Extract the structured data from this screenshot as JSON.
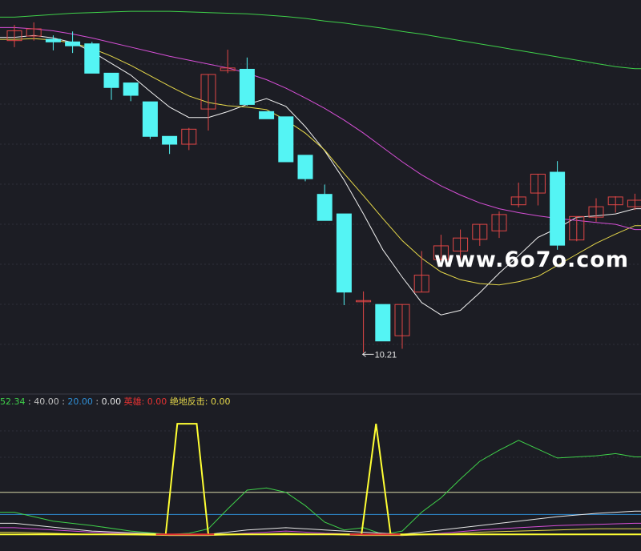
{
  "colors": {
    "background": "#1c1d24",
    "up_candle": "#e04646",
    "down_candle": "#54f4f4",
    "ma_short": "#f0f0f0",
    "ma_mid": "#e6d84a",
    "ma_long": "#d64fd6",
    "ma_longest": "#3fd14a",
    "divider": "#3a3b46"
  },
  "watermark": "www.6o7o.com",
  "chart_data": [
    {
      "type": "candlestick",
      "title": "",
      "xlabel": "",
      "ylabel": "",
      "ylim": [
        9.6,
        15.5
      ],
      "grid": true,
      "low_annotation": {
        "text": "10.21",
        "index": 18,
        "price": 10.21
      },
      "candles": [
        {
          "o": 15.0,
          "c": 15.15,
          "h": 15.24,
          "l": 14.9
        },
        {
          "o": 15.07,
          "c": 15.18,
          "h": 15.28,
          "l": 15.0
        },
        {
          "o": 15.02,
          "c": 14.98,
          "h": 15.08,
          "l": 14.85
        },
        {
          "o": 14.98,
          "c": 14.92,
          "h": 15.14,
          "l": 14.81
        },
        {
          "o": 14.95,
          "c": 14.5,
          "h": 14.98,
          "l": 14.5
        },
        {
          "o": 14.5,
          "c": 14.28,
          "h": 14.5,
          "l": 14.09
        },
        {
          "o": 14.35,
          "c": 14.16,
          "h": 14.35,
          "l": 14.07
        },
        {
          "o": 14.06,
          "c": 13.53,
          "h": 14.06,
          "l": 13.49
        },
        {
          "o": 13.53,
          "c": 13.41,
          "h": 13.53,
          "l": 13.26
        },
        {
          "o": 13.41,
          "c": 13.64,
          "h": 13.66,
          "l": 13.32
        },
        {
          "o": 13.95,
          "c": 14.48,
          "h": 14.48,
          "l": 13.62
        },
        {
          "o": 14.54,
          "c": 14.58,
          "h": 14.86,
          "l": 14.5
        },
        {
          "o": 14.56,
          "c": 14.02,
          "h": 14.74,
          "l": 14.0
        },
        {
          "o": 13.91,
          "c": 13.8,
          "h": 13.91,
          "l": 13.8
        },
        {
          "o": 13.83,
          "c": 13.14,
          "h": 13.83,
          "l": 13.14
        },
        {
          "o": 13.24,
          "c": 12.88,
          "h": 13.24,
          "l": 12.84
        },
        {
          "o": 12.64,
          "c": 12.24,
          "h": 12.79,
          "l": 12.24
        },
        {
          "o": 12.34,
          "c": 11.14,
          "h": 12.34,
          "l": 10.94
        },
        {
          "o": 11.01,
          "c": 11.01,
          "h": 11.15,
          "l": 10.21
        },
        {
          "o": 10.95,
          "c": 10.39,
          "h": 10.95,
          "l": 10.39
        },
        {
          "o": 10.47,
          "c": 10.95,
          "h": 10.95,
          "l": 10.27
        },
        {
          "o": 11.14,
          "c": 11.4,
          "h": 11.77,
          "l": 11.14
        },
        {
          "o": 11.64,
          "c": 11.85,
          "h": 12.02,
          "l": 11.63
        },
        {
          "o": 11.77,
          "c": 11.97,
          "h": 12.1,
          "l": 11.64
        },
        {
          "o": 11.95,
          "c": 12.18,
          "h": 12.18,
          "l": 11.85
        },
        {
          "o": 12.08,
          "c": 12.33,
          "h": 12.38,
          "l": 11.97
        },
        {
          "o": 12.48,
          "c": 12.6,
          "h": 12.82,
          "l": 12.44
        },
        {
          "o": 12.66,
          "c": 12.95,
          "h": 12.95,
          "l": 12.47
        },
        {
          "o": 12.98,
          "c": 11.86,
          "h": 13.15,
          "l": 11.79
        },
        {
          "o": 11.94,
          "c": 12.3,
          "h": 12.3,
          "l": 11.92
        },
        {
          "o": 12.29,
          "c": 12.45,
          "h": 12.58,
          "l": 12.22
        },
        {
          "o": 12.48,
          "c": 12.6,
          "h": 12.61,
          "l": 12.36
        },
        {
          "o": 12.45,
          "c": 12.55,
          "h": 12.65,
          "l": 12.4
        }
      ],
      "series": [
        {
          "values": [
            15.05,
            15.08,
            15.04,
            14.97,
            14.83,
            14.65,
            14.47,
            14.22,
            13.98,
            13.82,
            13.82,
            13.91,
            14.02,
            14.11,
            13.99,
            13.68,
            13.31,
            12.86,
            12.34,
            11.79,
            11.37,
            10.98,
            10.79,
            10.86,
            11.13,
            11.43,
            11.7,
            11.98,
            12.12,
            12.29,
            12.31,
            12.34,
            12.42
          ]
        },
        {
          "values": [
            15.02,
            15.03,
            15.01,
            14.96,
            14.88,
            14.76,
            14.62,
            14.46,
            14.3,
            14.15,
            14.05,
            14.0,
            13.98,
            13.94,
            13.78,
            13.58,
            13.32,
            12.96,
            12.62,
            12.27,
            11.93,
            11.66,
            11.45,
            11.33,
            11.27,
            11.25,
            11.3,
            11.38,
            11.55,
            11.72,
            11.89,
            12.03,
            12.16
          ]
        },
        {
          "values": [
            15.2,
            15.18,
            15.15,
            15.1,
            15.04,
            14.97,
            14.9,
            14.83,
            14.76,
            14.7,
            14.64,
            14.58,
            14.5,
            14.4,
            14.27,
            14.12,
            13.96,
            13.78,
            13.58,
            13.36,
            13.14,
            12.94,
            12.77,
            12.63,
            12.51,
            12.42,
            12.36,
            12.31,
            12.27,
            12.24,
            12.21,
            12.18,
            12.1
          ]
        },
        {
          "values": [
            15.36,
            15.38,
            15.4,
            15.42,
            15.43,
            15.44,
            15.45,
            15.45,
            15.45,
            15.44,
            15.43,
            15.42,
            15.41,
            15.39,
            15.37,
            15.34,
            15.3,
            15.27,
            15.23,
            15.19,
            15.14,
            15.1,
            15.05,
            15.0,
            14.95,
            14.9,
            14.85,
            14.8,
            14.75,
            14.7,
            14.65,
            14.6,
            14.57
          ]
        }
      ]
    },
    {
      "type": "line",
      "title": "",
      "ylim": [
        0,
        110
      ],
      "legend": [
        {
          "text": "52.34",
          "color": "#3fd14a"
        },
        {
          "text": "40.00",
          "color": "#c0c0c0"
        },
        {
          "text": "20.00",
          "color": "#2f8fd6"
        },
        {
          "text": "0.00",
          "color": "#e6e6e6"
        },
        {
          "text": "英雄: 0.00",
          "color": "#e63232"
        },
        {
          "text": "绝地反击: 0.00",
          "color": "#e6d84a"
        }
      ],
      "reference_levels": [
        40,
        20
      ],
      "indicator_series": [
        {
          "color": "#3fd14a",
          "x": [
            0,
            2,
            4,
            6,
            8,
            9,
            10,
            11,
            12,
            13,
            14,
            15,
            16,
            17,
            18,
            19,
            20,
            21,
            22,
            23,
            24,
            25,
            26,
            27,
            28,
            29,
            30,
            31,
            32
          ],
          "values": [
            22,
            14,
            10,
            5,
            2,
            3,
            7,
            25,
            42,
            44,
            40,
            28,
            13,
            6,
            8,
            2,
            5,
            22,
            35,
            52,
            68,
            78,
            87,
            79,
            71,
            72,
            73,
            75,
            72
          ]
        },
        {
          "color": "#e6e6e6",
          "x": [
            0,
            4,
            8,
            10,
            12,
            14,
            16,
            18,
            20,
            22,
            24,
            26,
            28,
            30,
            32
          ],
          "values": [
            12,
            5,
            2,
            2,
            6,
            8,
            6,
            4,
            2,
            6,
            10,
            14,
            18,
            21,
            23
          ]
        },
        {
          "color": "#d64fd6",
          "x": [
            0,
            4,
            8,
            10,
            12,
            14,
            16,
            18,
            20,
            22,
            24,
            26,
            28,
            30,
            32
          ],
          "values": [
            8,
            4,
            1,
            1,
            3,
            5,
            3,
            2,
            1,
            3,
            6,
            8,
            10,
            11,
            12
          ]
        },
        {
          "color": "#e6d84a",
          "x": [
            0,
            4,
            8,
            10,
            12,
            14,
            16,
            18,
            20,
            22,
            24,
            26,
            28,
            30,
            32
          ],
          "values": [
            4,
            2,
            1,
            1,
            2,
            3,
            2,
            1,
            1,
            2,
            4,
            5,
            6,
            7,
            7
          ]
        }
      ],
      "signal_series": {
        "color": "#ffff33",
        "x": [
          0,
          7.8,
          8.4,
          9.4,
          10.0,
          17.9,
          18.65,
          19.4,
          32
        ],
        "values": [
          2,
          2,
          102,
          102,
          2,
          2,
          102,
          2,
          2
        ]
      },
      "hero_series": {
        "color": "#e63232",
        "x": [
          7.3,
          10.3,
          17.3,
          19.9
        ],
        "values": [
          2,
          2,
          2,
          2
        ]
      }
    }
  ]
}
